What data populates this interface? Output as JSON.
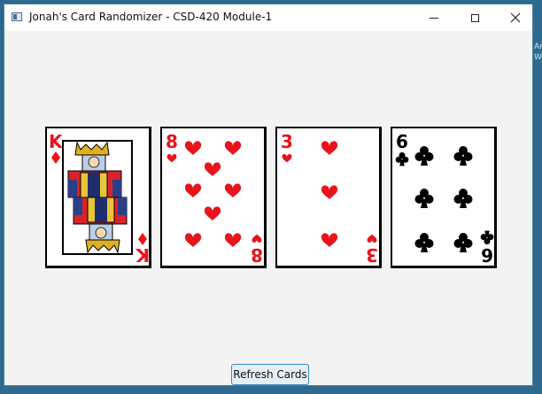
{
  "window": {
    "title": "Jonah's Card Randomizer - CSD-420 Module-1",
    "minimize_glyph": "",
    "maximize_glyph": "",
    "close_glyph": "✕"
  },
  "cards": [
    {
      "rank": "K",
      "suit": "diamonds",
      "color": "#e8141c"
    },
    {
      "rank": "8",
      "suit": "hearts",
      "color": "#e8141c"
    },
    {
      "rank": "3",
      "suit": "hearts",
      "color": "#e8141c"
    },
    {
      "rank": "6",
      "suit": "clubs",
      "color": "#000000"
    }
  ],
  "refresh_button": {
    "label": "Refresh Cards"
  },
  "background_edge": {
    "line1": "Ar",
    "line2": "W"
  },
  "colors": {
    "accent": "#3a8ac4",
    "desktop": "#2e6a8f"
  }
}
